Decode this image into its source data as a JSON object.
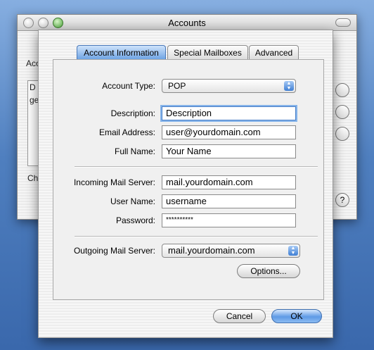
{
  "window": {
    "title": "Accounts"
  },
  "background": {
    "frag_acc": "Acc",
    "frag_list_header": "D",
    "frag_list_row": "ge",
    "frag_ch": "Ch",
    "help_glyph": "?"
  },
  "tabs": [
    {
      "label": "Account Information",
      "active": true
    },
    {
      "label": "Special Mailboxes",
      "active": false
    },
    {
      "label": "Advanced",
      "active": false
    }
  ],
  "form": {
    "account_type_label": "Account Type:",
    "account_type_value": "POP",
    "description_label": "Description:",
    "description_value": "Description",
    "email_label": "Email Address:",
    "email_value": "user@yourdomain.com",
    "fullname_label": "Full Name:",
    "fullname_value": "Your Name",
    "incoming_label": "Incoming Mail Server:",
    "incoming_value": "mail.yourdomain.com",
    "username_label": "User Name:",
    "username_value": "username",
    "password_label": "Password:",
    "password_value": "**********",
    "outgoing_label": "Outgoing Mail Server:",
    "outgoing_value": "mail.yourdomain.com",
    "options_label": "Options..."
  },
  "buttons": {
    "cancel": "Cancel",
    "ok": "OK"
  },
  "colors": {
    "accent": "#5e9ae6",
    "close_green": "#4aa53a"
  }
}
